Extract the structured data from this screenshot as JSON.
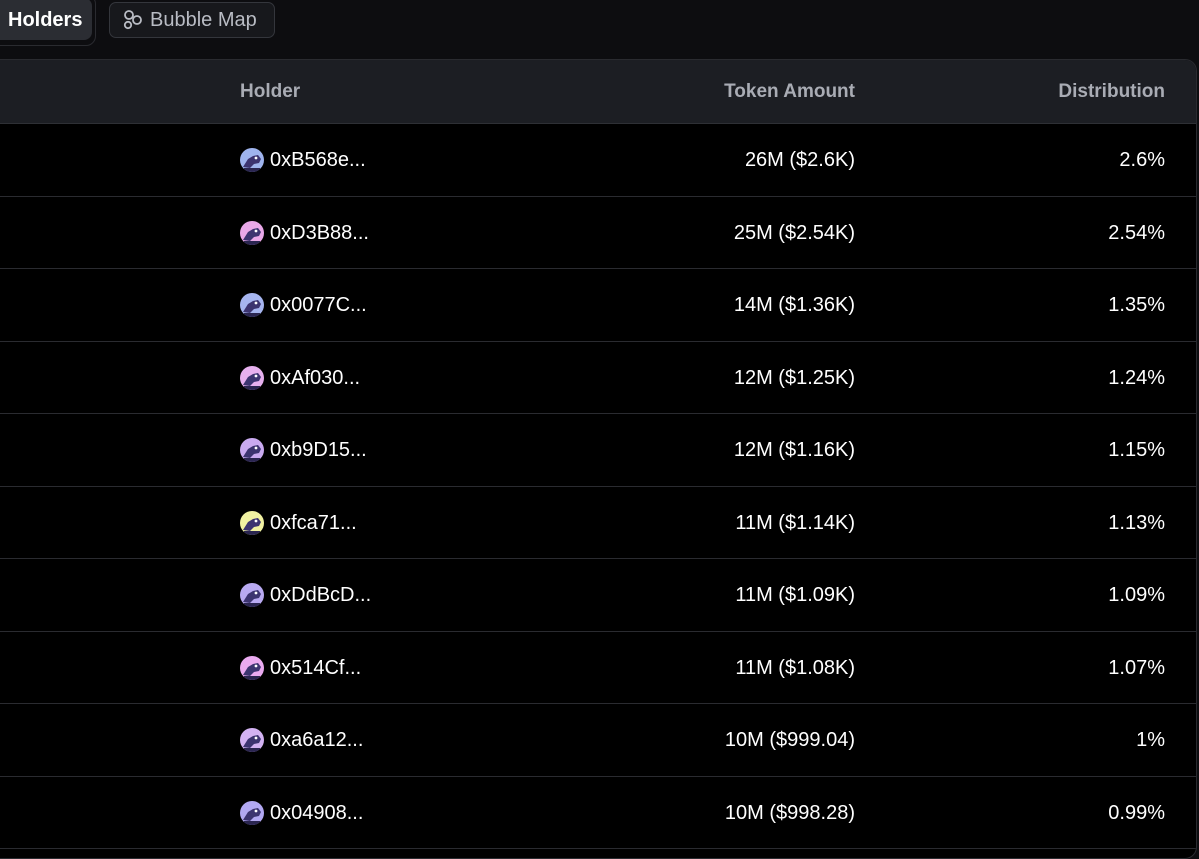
{
  "tabs": {
    "holders_label": "Holders",
    "bubble_map_label": "Bubble Map"
  },
  "table": {
    "columns": {
      "holder": "Holder",
      "token_amount": "Token Amount",
      "distribution": "Distribution"
    },
    "rows": [
      {
        "address": "0xB568e...",
        "amount": "26M ($2.6K)",
        "distribution": "2.6%",
        "avatar_bg": "#9fb4ee"
      },
      {
        "address": "0xD3B88...",
        "amount": "25M ($2.54K)",
        "distribution": "2.54%",
        "avatar_bg": "#e9a8e8"
      },
      {
        "address": "0x0077C...",
        "amount": "14M ($1.36K)",
        "distribution": "1.35%",
        "avatar_bg": "#a6b5f0"
      },
      {
        "address": "0xAf030...",
        "amount": "12M ($1.25K)",
        "distribution": "1.24%",
        "avatar_bg": "#e6b0ee"
      },
      {
        "address": "0xb9D15...",
        "amount": "12M ($1.16K)",
        "distribution": "1.15%",
        "avatar_bg": "#c9aaf0"
      },
      {
        "address": "0xfca71...",
        "amount": "11M ($1.14K)",
        "distribution": "1.13%",
        "avatar_bg": "#f1f2a2"
      },
      {
        "address": "0xDdBcD...",
        "amount": "11M ($1.09K)",
        "distribution": "1.09%",
        "avatar_bg": "#b9aaf2"
      },
      {
        "address": "0x514Cf...",
        "amount": "11M ($1.08K)",
        "distribution": "1.07%",
        "avatar_bg": "#eaaaf0"
      },
      {
        "address": "0xa6a12...",
        "amount": "10M ($999.04)",
        "distribution": "1%",
        "avatar_bg": "#d2b2f2"
      },
      {
        "address": "0x04908...",
        "amount": "10M ($998.28)",
        "distribution": "0.99%",
        "avatar_bg": "#b2a8f2"
      }
    ]
  }
}
